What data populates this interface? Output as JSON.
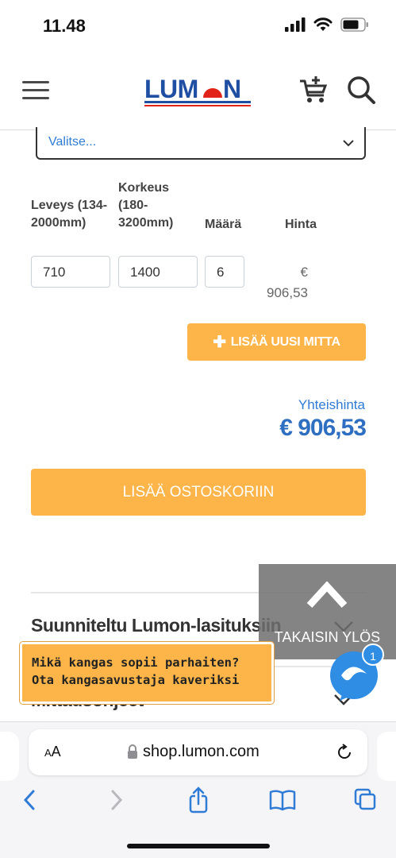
{
  "status": {
    "time": "11.48"
  },
  "header": {
    "logo_text": "LUMON"
  },
  "form": {
    "select_value": "Valitse...",
    "columns": {
      "width": "Leveys (134-2000mm)",
      "height": "Korkeus (180-3200mm)",
      "quantity": "Määrä",
      "price": "Hinta"
    },
    "row": {
      "width": "710",
      "height": "1400",
      "quantity": "6",
      "price_currency": "€",
      "price_value": "906,53"
    },
    "add_measure_label": "LISÄÄ UUSI MITTA",
    "total_label": "Yhteishinta",
    "total_value": "€ 906,53",
    "add_to_cart_label": "LISÄÄ OSTOSKORIIN"
  },
  "accordions": [
    {
      "title": "Suunniteltu Lumon-lasituksiin"
    },
    {
      "title": "Mittausohjeet"
    }
  ],
  "back_to_top": {
    "label": "TAKAISIN YLÖS"
  },
  "chat": {
    "promo_line1": "Mikä kangas sopii parhaiten?",
    "promo_line2": "Ota kangasavustaja kaveriksi",
    "badge_count": "1"
  },
  "browser": {
    "text_size": "AA",
    "url": "shop.lumon.com"
  },
  "colors": {
    "accent_orange": "#fdb549",
    "link_blue": "#2f7bd6",
    "brand_red": "#e2231a",
    "brand_blue": "#1f4fa3"
  }
}
